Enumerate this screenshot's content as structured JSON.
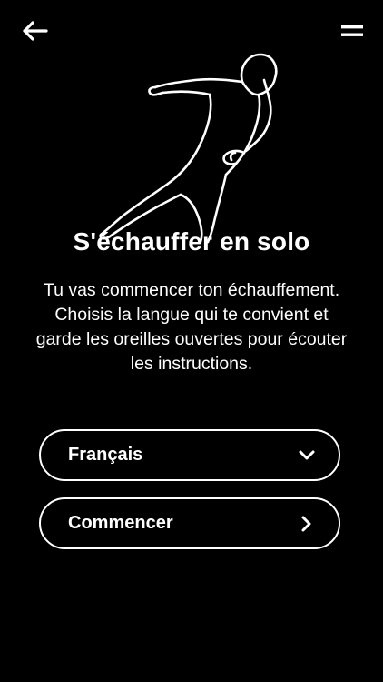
{
  "header": {
    "back_icon": "arrow-left-icon",
    "menu_icon": "menu-icon"
  },
  "illustration": {
    "icon": "stretching-person-outline",
    "stroke_color": "#ffffff"
  },
  "page": {
    "title": "S'échauffer en solo",
    "description": "Tu vas commencer ton échauffement. Choisis la langue qui te convient et garde les oreilles ouvertes pour écouter les instructions."
  },
  "language_select": {
    "selected_value": "Français",
    "icon": "chevron-down-icon"
  },
  "start_button": {
    "label": "Commencer",
    "icon": "chevron-right-icon"
  },
  "colors": {
    "background": "#000000",
    "foreground": "#ffffff"
  }
}
